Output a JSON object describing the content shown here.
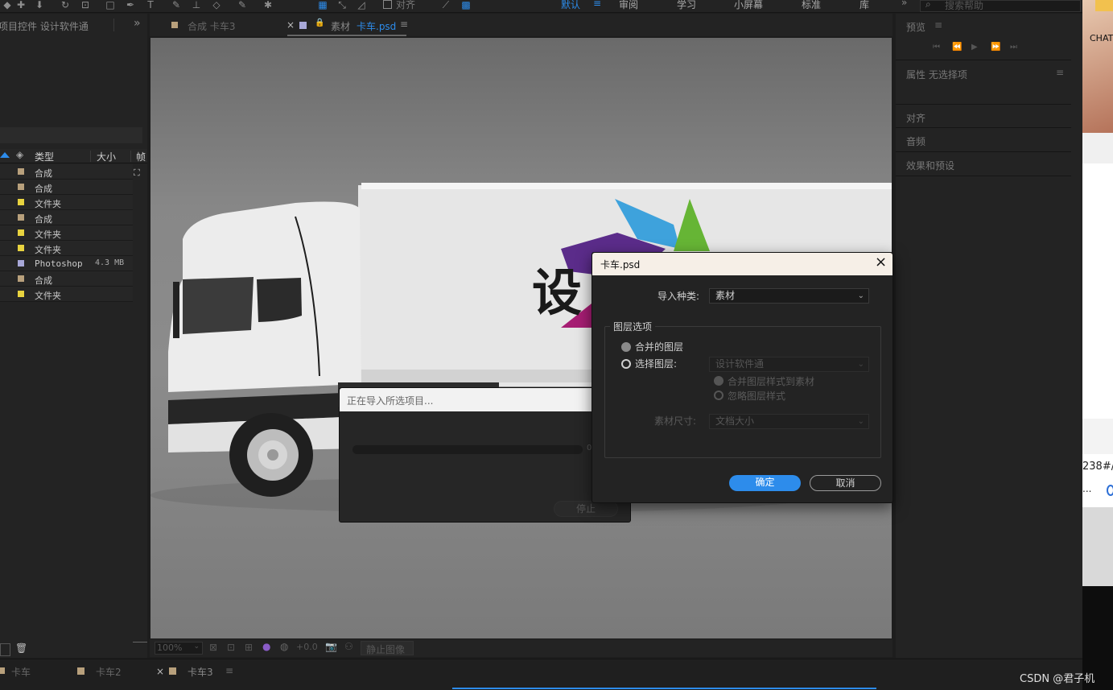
{
  "toolbar": {
    "align_label": "对齐",
    "workspaces": [
      "默认",
      "审阅",
      "学习",
      "小屏幕",
      "标准",
      "库"
    ],
    "search_placeholder": "搜索帮助"
  },
  "project_panel": {
    "title": "项目控件 设计软件通",
    "columns": {
      "type": "类型",
      "size": "大小",
      "frame": "帧"
    },
    "rows": [
      {
        "type": "合成",
        "size": "",
        "color": "#b8a07c"
      },
      {
        "type": "合成",
        "size": "",
        "color": "#b8a07c"
      },
      {
        "type": "文件夹",
        "size": "",
        "color": "#e8d33f"
      },
      {
        "type": "合成",
        "size": "",
        "color": "#b8a07c"
      },
      {
        "type": "文件夹",
        "size": "",
        "color": "#e8d33f"
      },
      {
        "type": "文件夹",
        "size": "",
        "color": "#e8d33f"
      },
      {
        "type": "Photoshop",
        "size": "4.3 MB",
        "color": "#a8a8d8"
      },
      {
        "type": "合成",
        "size": "",
        "color": "#b8a07c"
      },
      {
        "type": "文件夹",
        "size": "",
        "color": "#e8d33f"
      }
    ]
  },
  "viewer": {
    "tab_comp": "合成 卡车3",
    "tab_footage_prefix": "素材",
    "tab_footage_name": "卡车.psd",
    "truck_logo_text": "设",
    "zoom": "100%",
    "exposure": "+0.0",
    "still_image": "静止图像"
  },
  "right_panel": {
    "preview": "预览",
    "properties": "属性 无选择项",
    "align": "对齐",
    "audio": "音频",
    "effects": "效果和预设"
  },
  "timeline_tabs": [
    "卡车",
    "卡车2",
    "卡车3"
  ],
  "progress_dialog": {
    "message": "正在导入所选项目...",
    "percent_text": "0",
    "stop_label": "停止"
  },
  "import_dialog": {
    "title": "卡车.psd",
    "import_kind_label": "导入种类:",
    "import_kind_value": "素材",
    "layer_options_label": "图层选项",
    "merged_layers": "合并的图层",
    "choose_layer": "选择图层:",
    "choose_layer_value": "设计软件通",
    "merge_styles": "合并图层样式到素材",
    "ignore_styles": "忽略图层样式",
    "footage_size_label": "素材尺寸:",
    "footage_size_value": "文档大小",
    "ok_label": "确定",
    "cancel_label": "取消"
  },
  "browser_strip": {
    "top_text": "CHAT",
    "url_fragment": "238#/",
    "ellipsis": "..."
  },
  "watermark": "CSDN @君子机"
}
